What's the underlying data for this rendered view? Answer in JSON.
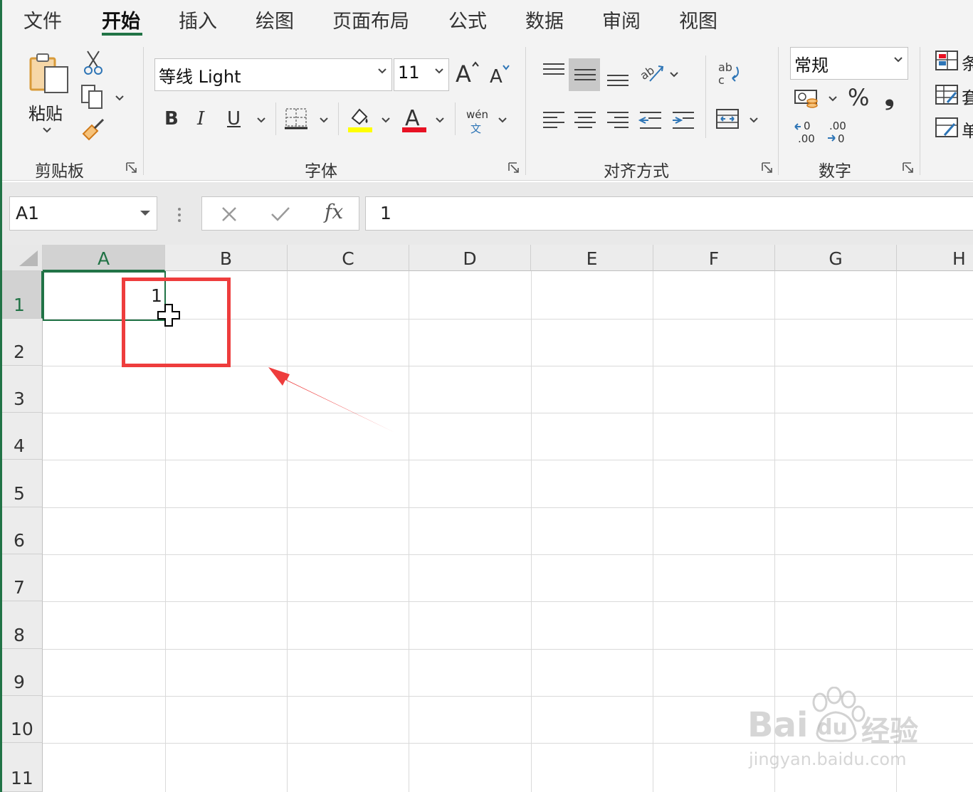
{
  "tabs": [
    {
      "label": "文件",
      "active": false
    },
    {
      "label": "开始",
      "active": true
    },
    {
      "label": "插入",
      "active": false
    },
    {
      "label": "绘图",
      "active": false
    },
    {
      "label": "页面布局",
      "active": false
    },
    {
      "label": "公式",
      "active": false
    },
    {
      "label": "数据",
      "active": false
    },
    {
      "label": "审阅",
      "active": false
    },
    {
      "label": "视图",
      "active": false
    }
  ],
  "ribbon": {
    "clipboard": {
      "group_label": "剪贴板",
      "paste_label": "粘贴"
    },
    "font": {
      "group_label": "字体",
      "font_name": "等线 Light",
      "font_size": "11",
      "bold": "B",
      "italic": "I",
      "underline": "U",
      "phonetic_top": "wén",
      "phonetic_bottom": "文",
      "highlight_color": "#ffff00",
      "font_color": "#e81123"
    },
    "alignment": {
      "group_label": "对齐方式"
    },
    "number": {
      "group_label": "数字",
      "format": "常规",
      "percent": "%",
      "comma": "❟",
      "inc_decimal": ".00",
      "dec_decimal": ".0"
    },
    "styles": {
      "items": [
        "条",
        "套",
        "单"
      ]
    }
  },
  "formula_bar": {
    "name_box": "A1",
    "fx_label": "fx",
    "formula": "1"
  },
  "sheet": {
    "columns": [
      "A",
      "B",
      "C",
      "D",
      "E",
      "F",
      "G",
      "H"
    ],
    "rows": [
      "1",
      "2",
      "3",
      "4",
      "5",
      "6",
      "7",
      "8",
      "9",
      "10",
      "11"
    ],
    "selected_column": "A",
    "selected_row": "1",
    "cell_A1": "1"
  },
  "watermark": {
    "brand_left": "Bai",
    "brand_paw": "du",
    "brand_right": "经验",
    "url": "jingyan.baidu.com"
  },
  "accent_color": "#217346",
  "annotation_color": "#ee3d3d"
}
